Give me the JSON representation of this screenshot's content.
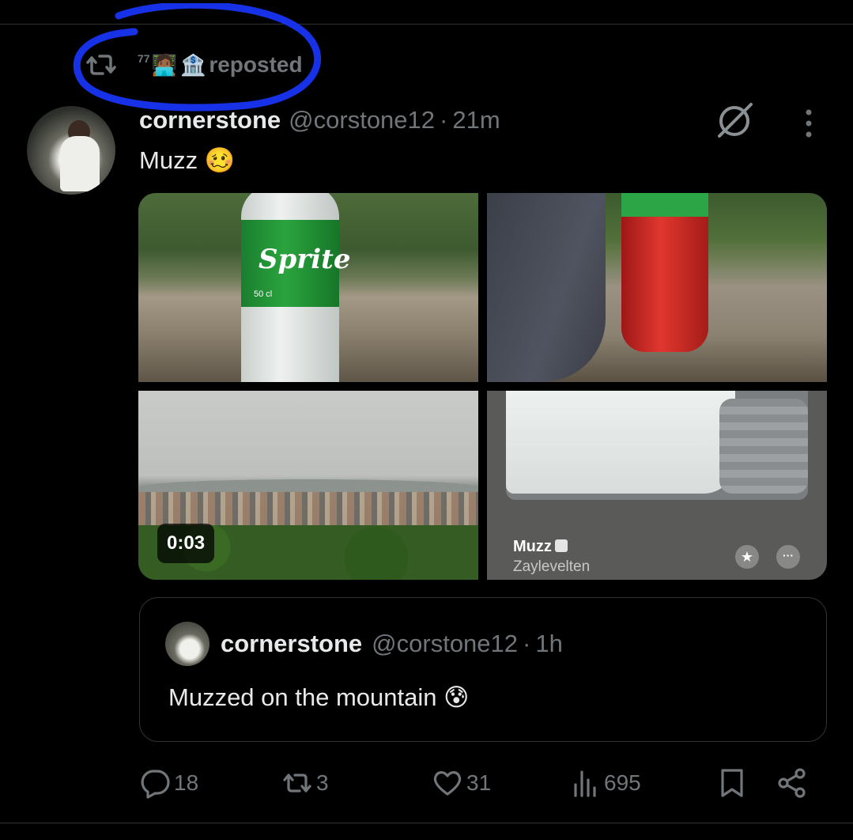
{
  "repost": {
    "count": "77",
    "person_emoji": "🧑🏾‍💻",
    "bank_emoji": "🏦",
    "label": "reposted"
  },
  "post": {
    "display_name": "cornerstone",
    "handle": "@corstone12",
    "separator": "·",
    "time": "21m",
    "text": "Muzz 🥴"
  },
  "media": {
    "bottle_brand": "Sprite",
    "bottle_volume": "50 cl",
    "video_duration": "0:03",
    "music_title": "Muzz",
    "music_artist": "Zaylevelten",
    "star_glyph": "★",
    "dots_glyph": "···"
  },
  "quote": {
    "display_name": "cornerstone",
    "handle": "@corstone12",
    "separator": "·",
    "time": "1h",
    "text": "Muzzed on the mountain 😰"
  },
  "actions": {
    "replies": "18",
    "reposts": "3",
    "likes": "31",
    "views": "695"
  },
  "colors": {
    "background": "#000000",
    "text_primary": "#e7e9ea",
    "text_secondary": "#71767b",
    "border": "#2f3336",
    "annotation": "#1631e6"
  },
  "icons": [
    "repost-icon",
    "grok-icon",
    "more-icon",
    "reply-icon",
    "like-icon",
    "views-icon",
    "bookmark-icon",
    "share-icon"
  ]
}
